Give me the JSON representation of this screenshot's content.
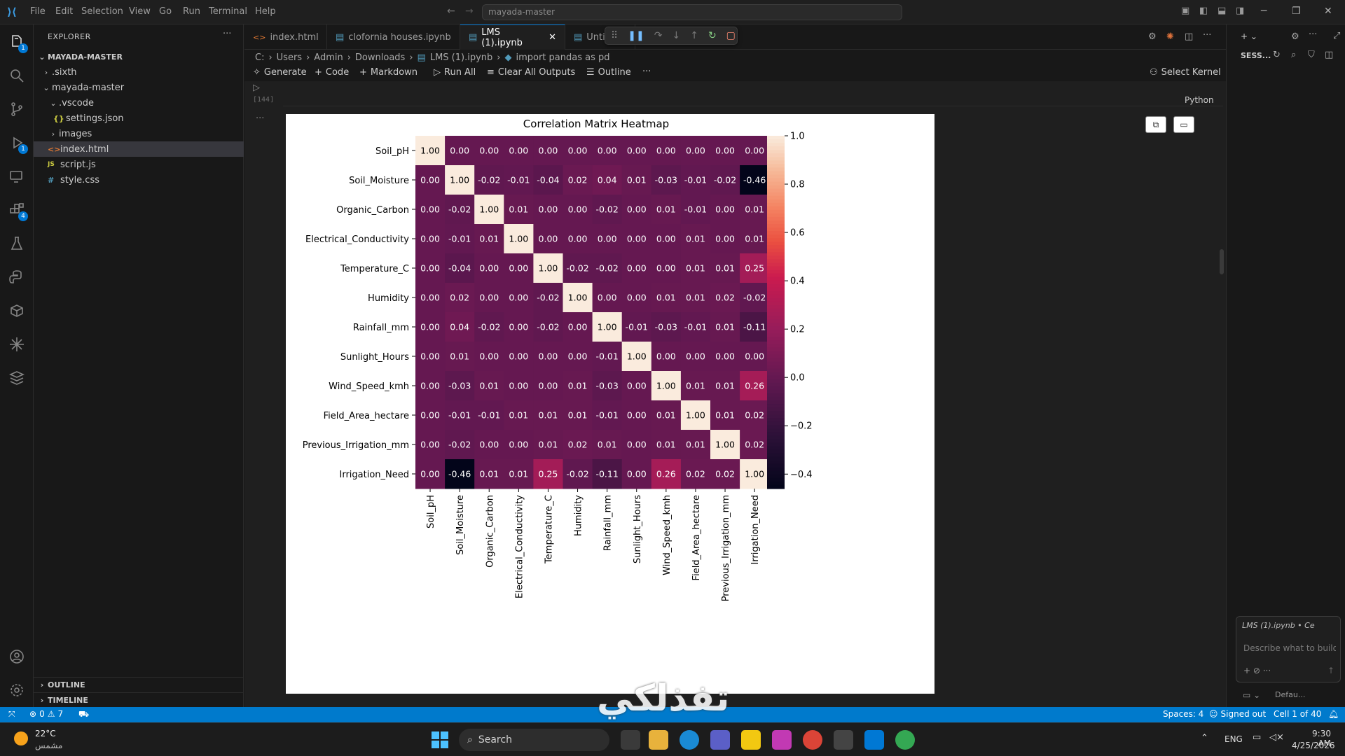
{
  "titlebar": {
    "menu": [
      "File",
      "Edit",
      "Selection",
      "View",
      "Go",
      "Run",
      "Terminal",
      "Help"
    ],
    "search": "mayada-master"
  },
  "sidebar": {
    "title": "EXPLORER",
    "root": "MAYADA-MASTER",
    "items": [
      {
        "label": ".sixth",
        "icon": "chevron-right"
      },
      {
        "label": "mayada-master",
        "icon": "chevron-down"
      },
      {
        "label": ".vscode",
        "icon": "chevron-down"
      },
      {
        "label": "settings.json",
        "icon": "json-icon"
      },
      {
        "label": "images",
        "icon": "chevron-right"
      },
      {
        "label": "index.html",
        "icon": "html-icon"
      },
      {
        "label": "script.js",
        "icon": "js-icon"
      },
      {
        "label": "style.css",
        "icon": "css-icon"
      }
    ],
    "outline": "OUTLINE",
    "timeline": "TIMELINE"
  },
  "tabs": [
    {
      "label": "index.html"
    },
    {
      "label": "clofornia houses.ipynb"
    },
    {
      "label": "LMS (1).ipynb"
    },
    {
      "label": "Untitl"
    }
  ],
  "breadcrumb": [
    "C:",
    "Users",
    "Admin",
    "Downloads",
    "LMS (1).ipynb",
    "import pandas as pd"
  ],
  "notebook_toolbar": {
    "generate": "Generate",
    "code": "Code",
    "markdown": "Markdown",
    "run_all": "Run All",
    "clear_outputs": "Clear All Outputs",
    "outline": "Outline",
    "select_kernel": "Select Kernel",
    "language": "Python",
    "exec_count": "[144]"
  },
  "secondary": {
    "title": "SESS...",
    "chat_tab": "LMS (1).ipynb • Ce",
    "chat_placeholder": "Describe what to build",
    "mode": "Defau..."
  },
  "statusbar": {
    "problems": "0",
    "warnings": "7",
    "spaces": "Spaces: 4",
    "account": "Signed out",
    "cell": "Cell 1 of 40"
  },
  "taskbar": {
    "weather_temp": "22°C",
    "weather_desc": "مشمس",
    "search": "Search",
    "lang": "ENG",
    "time": "9:30 AM",
    "date": "4/25/2026"
  },
  "watermark": "تفذلكي",
  "chart_data": {
    "type": "heatmap",
    "title": "Correlation Matrix Heatmap",
    "labels": [
      "Soil_pH",
      "Soil_Moisture",
      "Organic_Carbon",
      "Electrical_Conductivity",
      "Temperature_C",
      "Humidity",
      "Rainfall_mm",
      "Sunlight_Hours",
      "Wind_Speed_kmh",
      "Field_Area_hectare",
      "Previous_Irrigation_mm",
      "Irrigation_Need"
    ],
    "matrix": [
      [
        1.0,
        -0.0,
        -0.0,
        -0.0,
        -0.0,
        0.0,
        -0.0,
        0.0,
        0.0,
        0.0,
        0.0,
        0.0
      ],
      [
        -0.0,
        1.0,
        -0.02,
        -0.01,
        -0.04,
        0.02,
        0.04,
        0.01,
        -0.03,
        -0.01,
        -0.02,
        -0.46
      ],
      [
        -0.0,
        -0.02,
        1.0,
        0.01,
        -0.0,
        0.0,
        -0.02,
        -0.0,
        0.01,
        -0.01,
        -0.0,
        0.01
      ],
      [
        -0.0,
        -0.01,
        0.01,
        1.0,
        0.0,
        0.0,
        -0.0,
        0.0,
        -0.0,
        0.01,
        0.0,
        0.01
      ],
      [
        -0.0,
        -0.04,
        -0.0,
        0.0,
        1.0,
        -0.02,
        -0.02,
        -0.0,
        -0.0,
        0.01,
        0.01,
        0.25
      ],
      [
        0.0,
        0.02,
        0.0,
        0.0,
        -0.02,
        1.0,
        0.0,
        0.0,
        0.01,
        0.01,
        0.02,
        -0.02
      ],
      [
        -0.0,
        0.04,
        -0.02,
        -0.0,
        -0.02,
        0.0,
        1.0,
        -0.01,
        -0.03,
        -0.01,
        0.01,
        -0.11
      ],
      [
        0.0,
        0.01,
        -0.0,
        0.0,
        -0.0,
        0.0,
        -0.01,
        1.0,
        0.0,
        -0.0,
        0.0,
        -0.0
      ],
      [
        0.0,
        -0.03,
        0.01,
        -0.0,
        -0.0,
        0.01,
        -0.03,
        0.0,
        1.0,
        0.01,
        0.01,
        0.26
      ],
      [
        0.0,
        -0.01,
        -0.01,
        0.01,
        0.01,
        0.01,
        -0.01,
        -0.0,
        0.01,
        1.0,
        0.01,
        0.02
      ],
      [
        0.0,
        -0.02,
        -0.0,
        0.0,
        0.01,
        0.02,
        0.01,
        0.0,
        0.01,
        0.01,
        1.0,
        0.02
      ],
      [
        0.0,
        -0.46,
        0.01,
        0.01,
        0.25,
        -0.02,
        -0.11,
        -0.0,
        0.26,
        0.02,
        0.02,
        1.0
      ]
    ],
    "colorbar": {
      "min": -0.46,
      "max": 1.0,
      "ticks": [
        "1.0",
        "0.8",
        "0.6",
        "0.4",
        "0.2",
        "0.0",
        "−0.2",
        "−0.4"
      ],
      "tick_values": [
        1.0,
        0.8,
        0.6,
        0.4,
        0.2,
        0.0,
        -0.2,
        -0.4
      ]
    },
    "colormap": "rocket"
  }
}
